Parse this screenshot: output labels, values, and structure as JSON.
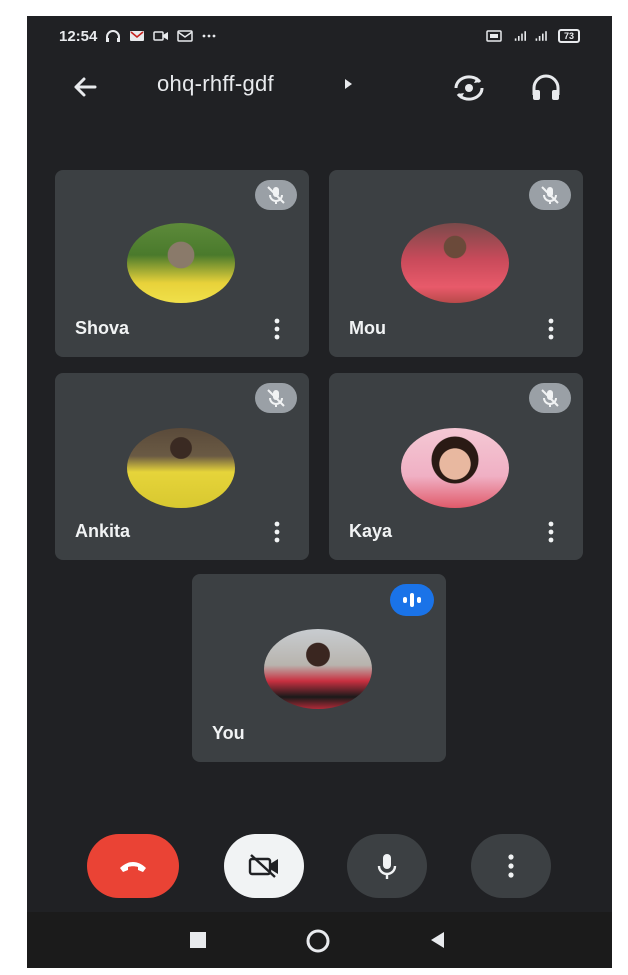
{
  "status_bar": {
    "time": "12:54",
    "battery": "73"
  },
  "header": {
    "meeting_code": "ohq-rhff-gdf"
  },
  "participants": [
    {
      "name": "Shova",
      "muted": true
    },
    {
      "name": "Mou",
      "muted": true
    },
    {
      "name": "Ankita",
      "muted": true
    },
    {
      "name": "Kaya",
      "muted": true
    },
    {
      "name": "You",
      "speaking": true
    }
  ],
  "icons": {
    "back": "arrow-left-icon",
    "flip_camera": "flip-camera-icon",
    "audio_output": "headphones-icon",
    "end_call": "phone-hangup-icon",
    "camera_off": "video-off-icon",
    "mic": "microphone-icon",
    "more": "more-vertical-icon"
  },
  "colors": {
    "background": "#202124",
    "tile": "#3c4043",
    "end_call": "#ea4335",
    "speaking": "#1a73e8"
  }
}
